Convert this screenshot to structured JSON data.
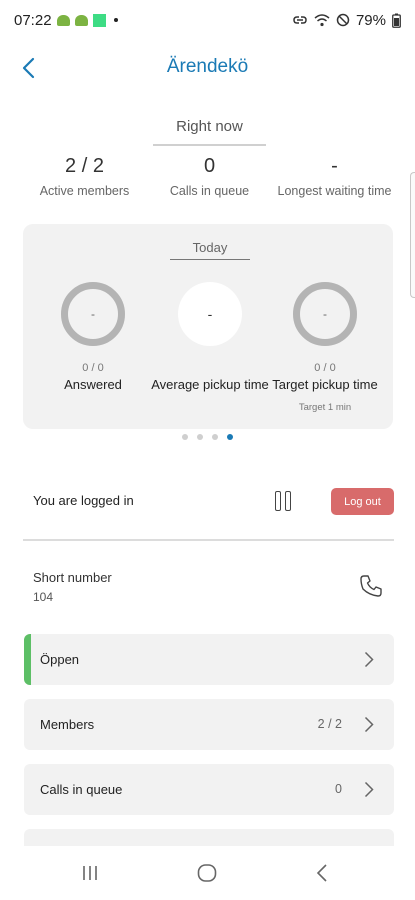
{
  "status_bar": {
    "time": "07:22",
    "battery": "79%"
  },
  "header": {
    "title": "Ärendekö"
  },
  "right_now": {
    "tab_label": "Right now",
    "stats": [
      {
        "value": "2 / 2",
        "label": "Active members"
      },
      {
        "value": "0",
        "label": "Calls in queue"
      },
      {
        "value": "-",
        "label": "Longest waiting time"
      }
    ]
  },
  "today": {
    "tab_label": "Today",
    "gauges": [
      {
        "center": "-",
        "count": "0 / 0",
        "label": "Answered",
        "sub": ""
      },
      {
        "center": "-",
        "count": "",
        "label": "Average pickup time",
        "sub": ""
      },
      {
        "center": "-",
        "count": "0 / 0",
        "label": "Target pickup time",
        "sub": "Target 1 min"
      }
    ],
    "pager_total": 4,
    "pager_active": 3
  },
  "login": {
    "text": "You are logged in",
    "logout_label": "Log out"
  },
  "short_number": {
    "label": "Short number",
    "value": "104"
  },
  "list": [
    {
      "label": "Öppen",
      "count": ""
    },
    {
      "label": "Members",
      "count": "2 / 2"
    },
    {
      "label": "Calls in queue",
      "count": "0"
    }
  ],
  "colors": {
    "accent": "#1a7ab5",
    "logout": "#d86b6b",
    "open_status": "#5dbf66"
  },
  "icons": {
    "back": "chevron-left-icon",
    "pause": "pause-icon",
    "phone": "phone-icon",
    "chevron": "chevron-right-icon",
    "nav_recents": "recents-icon",
    "nav_home": "home-icon",
    "nav_back": "back-icon"
  }
}
